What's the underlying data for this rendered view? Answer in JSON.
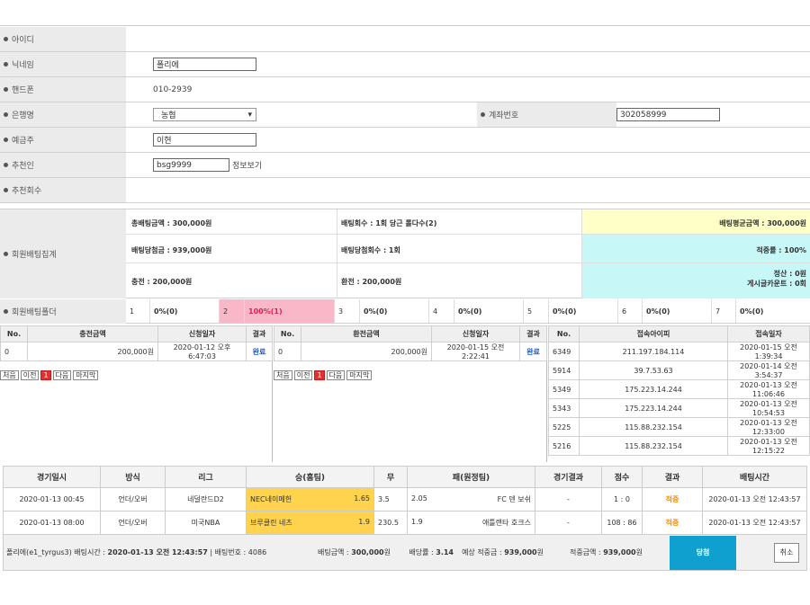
{
  "member_form": {
    "rows": [
      {
        "label": "아이디",
        "value": ""
      },
      {
        "label": "닉네임",
        "value": "폴리에"
      },
      {
        "label": "핸드폰",
        "value": "010-2939"
      },
      {
        "label": "은행명",
        "value": "농협"
      },
      {
        "label": "예금주",
        "value": "이현"
      },
      {
        "label": "추천인",
        "value": "bsg9999",
        "extra": "정보보기"
      },
      {
        "label": "추천회수",
        "value": ""
      }
    ],
    "account_label": "계좌번호",
    "account_value": "302058999"
  },
  "summary": {
    "label": "회원배팅집계",
    "cells": [
      "총배팅금액 : 300,000원",
      "배팅회수 : 1회 당근 롤다수(2)",
      "배팅평균금액 : 300,000원",
      "배팅당첨금 : 939,000원",
      "배팅당첨회수 : 1회",
      "적중률 : 100%",
      "충전 : 200,000원",
      "환전 : 200,000원",
      "정산 : 0원",
      "게시글카운트 : 0회"
    ]
  },
  "folder_stats": {
    "label": "회원배팅폴더",
    "items": [
      {
        "n": "1",
        "v": "0%(0)"
      },
      {
        "n": "2",
        "v": "100%(1)"
      },
      {
        "n": "3",
        "v": "0%(0)"
      },
      {
        "n": "4",
        "v": "0%(0)"
      },
      {
        "n": "5",
        "v": "0%(0)"
      },
      {
        "n": "6",
        "v": "0%(0)"
      },
      {
        "n": "7",
        "v": "0%(0)"
      }
    ]
  },
  "charge_panel": {
    "headers": [
      "No.",
      "충전금액",
      "신청일자",
      "결과"
    ],
    "row": [
      "0",
      "200,000원",
      "2020-01-12 오후 6:47:03",
      "완료"
    ],
    "pager": [
      "처음",
      "이전",
      "1",
      "다음",
      "마지막"
    ]
  },
  "exchange_panel": {
    "headers": [
      "No.",
      "환전금액",
      "신청일자",
      "결과"
    ],
    "row": [
      "0",
      "200,000원",
      "2020-01-15 오전 2:22:41",
      "완료"
    ],
    "pager": [
      "처음",
      "이전",
      "1",
      "다음",
      "마지막"
    ]
  },
  "login_panel": {
    "headers": [
      "No.",
      "접속아이피",
      "접속일자"
    ],
    "rows": [
      [
        "6349",
        "211.197.184.114",
        "2020-01-15 오전 1:39:34"
      ],
      [
        "5914",
        "39.7.53.63",
        "2020-01-14 오전 3:54:37"
      ],
      [
        "5349",
        "175.223.14.244",
        "2020-01-13 오전 11:06:46"
      ],
      [
        "5343",
        "175.223.14.244",
        "2020-01-13 오전 10:54:53"
      ],
      [
        "5225",
        "115.88.232.154",
        "2020-01-13 오전 12:33:00"
      ],
      [
        "5216",
        "115.88.232.154",
        "2020-01-13 오전 12:15:22"
      ]
    ]
  },
  "bet_table": {
    "headers": [
      "경기일시",
      "방식",
      "리그",
      "승(홈팀)",
      "무",
      "패(원정팀)",
      "경기결과",
      "점수",
      "결과",
      "배팅시간"
    ],
    "rows": [
      {
        "date": "2020-01-13 00:45",
        "type": "언더/오버",
        "league": "네덜란드D2",
        "home": "NEC네이메헌",
        "home_odds": "1.65",
        "draw": "3.5",
        "away_odds": "2.05",
        "away": "FC 덴 보쉬",
        "game_result": "-",
        "score": "1 : 0",
        "result": "적중",
        "time": "2020-01-13 오전 12:43:57"
      },
      {
        "date": "2020-01-13 08:00",
        "type": "언더/오버",
        "league": "미국NBA",
        "home": "브루클린 네츠",
        "home_odds": "1.9",
        "draw": "230.5",
        "away_odds": "1.9",
        "away": "애틀랜타 호크스",
        "game_result": "-",
        "score": "108 : 86",
        "result": "적중",
        "time": "2020-01-13 오전 12:43:57"
      }
    ],
    "footer": {
      "info_prefix": "폴리에(e1_tyrgus3) 배팅시간 : ",
      "info_time": "2020-01-13 오전 12:43:57",
      "info_suffix": " | 배팅번호 : 4086",
      "amount_label": "배팅금액 : ",
      "amount": "300,000",
      "amount_unit": "원",
      "rate_label": "배당률 : ",
      "rate": "3.14",
      "expect_label": "예상 적중금 : ",
      "expect": "939,000",
      "expect_unit": "원",
      "hit_label": "적중금액 : ",
      "hit": "939,000",
      "hit_unit": "원",
      "status_btn": "당첨",
      "cancel_btn": "취소"
    }
  },
  "colors": {
    "yellow_cell": "#ffffc8",
    "cyan_cell": "#c8f7f7",
    "pink_cell": "#f9b8c8",
    "win_blue": "#0fa0d0",
    "odds_yellow": "#ffd34e"
  }
}
